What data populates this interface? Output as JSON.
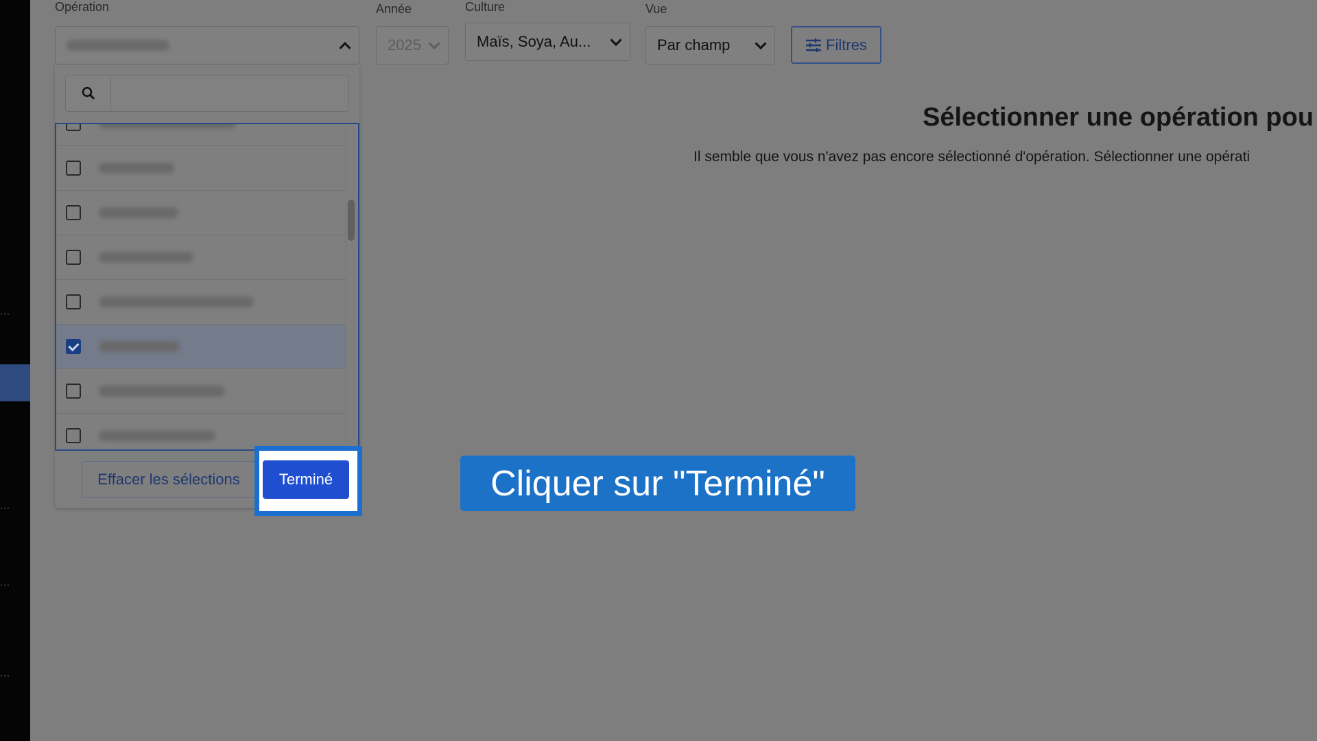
{
  "filters": {
    "operation_label": "Opération",
    "year_label": "Année",
    "year_value": "2025",
    "crop_label": "Culture",
    "crop_value": "Maïs, Soya, Au...",
    "view_label": "Vue",
    "view_value": "Par champ",
    "filters_button": "Filtres"
  },
  "dropdown": {
    "search_placeholder": "",
    "items": [
      {
        "checked": false
      },
      {
        "checked": false
      },
      {
        "checked": false
      },
      {
        "checked": false
      },
      {
        "checked": false
      },
      {
        "checked": true
      },
      {
        "checked": false
      },
      {
        "checked": false
      }
    ],
    "clear_button": "Effacer les sélections",
    "done_button": "Terminé"
  },
  "empty_state": {
    "title": "Sélectionner une opération pou",
    "subtitle": "Il semble que vous n'avez pas encore sélectionné d'opération. Sélectionner une opérati"
  },
  "callout": {
    "text": "Cliquer sur \"Terminé\""
  },
  "colors": {
    "accent_blue": "#1f4fd0",
    "callout_blue": "#1c72c6",
    "overlay_gray": "#7e7e7e",
    "sidebar": "#050505"
  }
}
